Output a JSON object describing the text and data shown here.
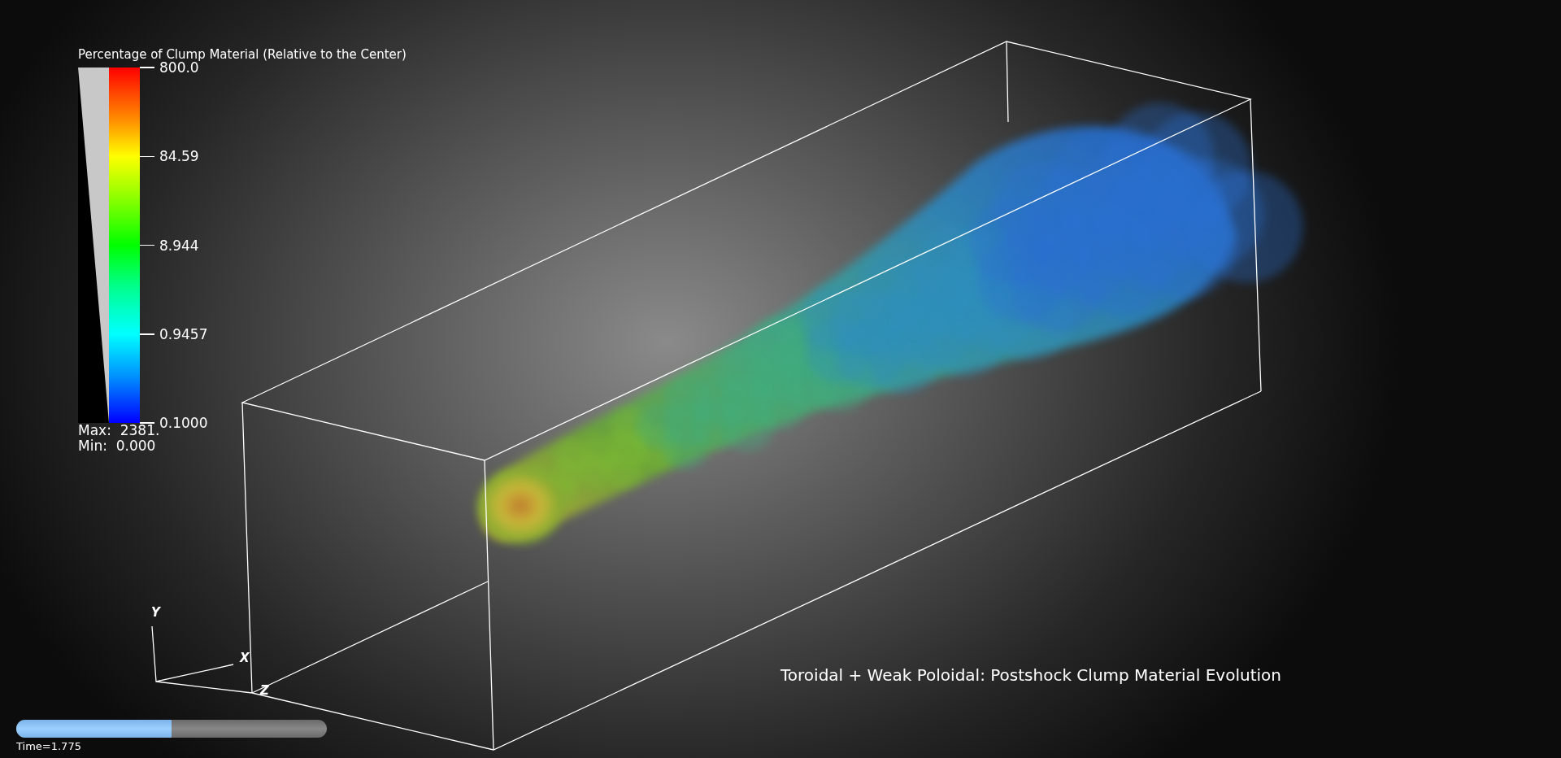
{
  "legend": {
    "title": "Percentage of Clump Material (Relative to the Center)",
    "ticks": [
      "800.0",
      "84.59",
      "8.944",
      "0.9457",
      "0.1000"
    ],
    "max": "Max:  2381.",
    "min": "Min:  0.000"
  },
  "axes": {
    "y": "Y",
    "x": "X",
    "z": "Z"
  },
  "time_slider": {
    "level": 0.5,
    "label": "Time=1.775"
  },
  "title": "Toroidal + Weak Poloidal: Postshock Clump Material Evolution"
}
